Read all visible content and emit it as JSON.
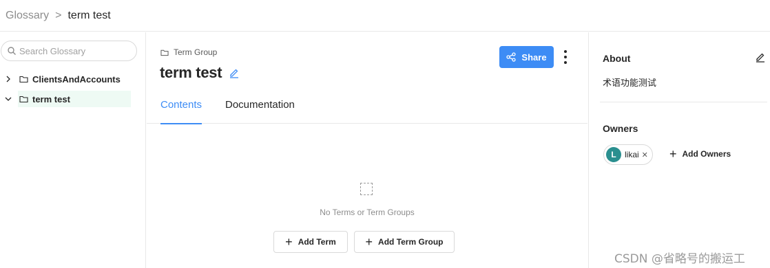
{
  "breadcrumb": {
    "root": "Glossary",
    "separator": ">",
    "current": "term test"
  },
  "sidebar": {
    "search": {
      "placeholder": "Search Glossary",
      "value": ""
    },
    "items": [
      {
        "label": "ClientsAndAccounts",
        "expanded": false,
        "selected": false
      },
      {
        "label": "term test",
        "expanded": true,
        "selected": true
      }
    ]
  },
  "main": {
    "group_label": "Term Group",
    "title": "term test",
    "share_label": "Share",
    "tabs": [
      {
        "label": "Contents",
        "active": true
      },
      {
        "label": "Documentation",
        "active": false
      }
    ],
    "empty_text": "No Terms or Term Groups",
    "add_term_label": "Add Term",
    "add_term_group_label": "Add Term Group"
  },
  "about": {
    "title": "About",
    "description": "术语功能测试"
  },
  "owners": {
    "title": "Owners",
    "list": [
      {
        "initial": "L",
        "name": "likai"
      }
    ],
    "add_label": "Add Owners"
  },
  "watermark": "CSDN @省略号的搬运工",
  "colors": {
    "accent": "#3d8cf5",
    "avatar": "#2a8f8f",
    "selected_bg": "#eefaf4"
  }
}
